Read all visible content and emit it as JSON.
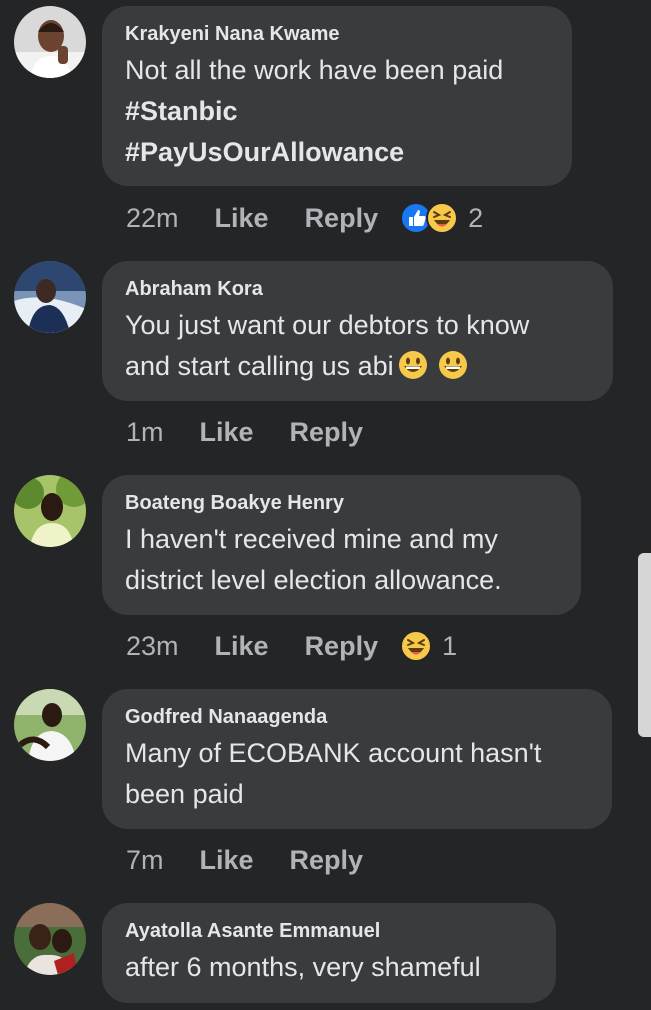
{
  "comments": [
    {
      "author": "Krakyeni Nana Kwame",
      "lines": [
        "Not all the work have been paid"
      ],
      "tags": [
        "#Stanbic",
        "#PayUsOurAllowance"
      ],
      "time": "22m",
      "like_label": "Like",
      "reply_label": "Reply",
      "reactions": [
        "like-reaction-icon",
        "haha-reaction-icon"
      ],
      "reaction_count": "2"
    },
    {
      "author": "Abraham Kora",
      "lines": [
        "You just want our debtors to know",
        "and start calling us abi"
      ],
      "time": "1m",
      "like_label": "Like",
      "reply_label": "Reply"
    },
    {
      "author": "Boateng Boakye Henry",
      "lines": [
        "I haven't received mine and my",
        "district level election allowance."
      ],
      "time": "23m",
      "like_label": "Like",
      "reply_label": "Reply",
      "reactions": [
        "haha-reaction-icon"
      ],
      "reaction_count": "1"
    },
    {
      "author": "Godfred Nanaagenda",
      "lines": [
        "Many of ECOBANK account hasn't",
        "been paid"
      ],
      "time": "7m",
      "like_label": "Like",
      "reply_label": "Reply"
    },
    {
      "author": "Ayatolla Asante Emmanuel",
      "lines": [
        "after 6 months, very shameful"
      ]
    }
  ],
  "colors": {
    "background": "#242526",
    "bubble": "#3a3b3c",
    "text": "#e4e6eb",
    "secondary_text": "#b0b3b8",
    "like_blue": "#1877f2",
    "haha_yellow": "#f7c94b"
  }
}
